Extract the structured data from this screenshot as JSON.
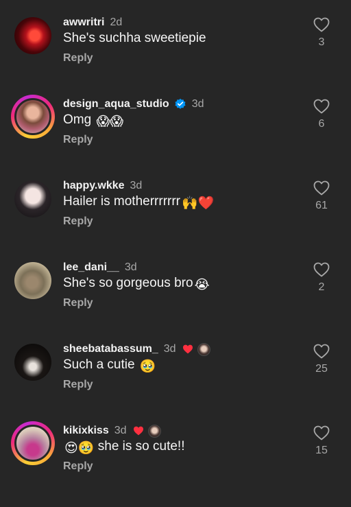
{
  "colors": {
    "background": "#262626",
    "text_primary": "#f5f5f5",
    "text_secondary": "#a8a8a8",
    "verified_blue": "#0095f6",
    "heart_red": "#ff3040"
  },
  "reply_label": "Reply",
  "comments": [
    {
      "username": "awwritri",
      "time": "2d",
      "text": "She's suchha sweetiepie",
      "likes": "3",
      "avatar_icon": "avatar-photo"
    },
    {
      "username": "design_aqua_studio",
      "verified": true,
      "time": "3d",
      "text": "Omg",
      "emojis": "😱😱",
      "likes": "6",
      "avatar_icon": "avatar-photo",
      "story_ring": true
    },
    {
      "username": "happy.wkke",
      "time": "3d",
      "text": "Hailer is motherrrrrrr",
      "emojis": "🙌❤️",
      "likes": "61",
      "avatar_icon": "avatar-photo"
    },
    {
      "username": "lee_dani__",
      "time": "3d",
      "text": "She's so gorgeous bro",
      "emojis": "😭",
      "likes": "2",
      "avatar_icon": "avatar-photo"
    },
    {
      "username": "sheebatabassum_",
      "time": "3d",
      "text": "Such a cutie",
      "emojis": "🥹",
      "likes": "25",
      "avatar_icon": "avatar-photo",
      "liked_by_creator": true
    },
    {
      "username": "kikixkiss",
      "time": "3d",
      "text": "she is so cute!!",
      "lead_emojis": "😍🥹",
      "likes": "15",
      "avatar_icon": "avatar-photo",
      "story_ring": true,
      "liked_by_creator": true
    }
  ]
}
